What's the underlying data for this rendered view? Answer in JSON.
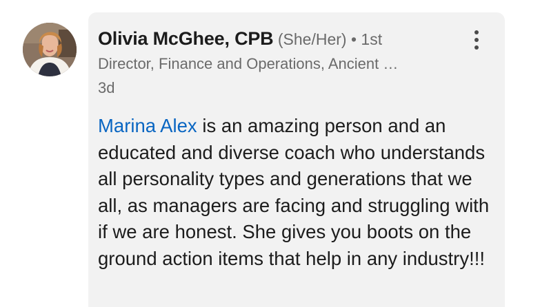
{
  "comment": {
    "author": {
      "name": "Olivia McGhee, CPB",
      "pronouns": "(She/Her)",
      "separator": " • ",
      "connection_degree": "1st",
      "headline": "Director, Finance and Operations, Ancient …",
      "avatar_icon": "profile-photo"
    },
    "timestamp": "3d",
    "more_icon": "three-dots-vertical-icon",
    "mention": "Marina Alex",
    "body": " is an amazing person and an educated and diverse coach who understands all personality types and generations that we all, as managers are facing and struggling with if we are honest. She gives you boots on the ground action items that help in any industry!!!"
  },
  "colors": {
    "mention": "#0a66c2",
    "bubble_background": "#f2f2f2",
    "primary_text": "#1c1c1c",
    "secondary_text": "#6a6a6a"
  }
}
